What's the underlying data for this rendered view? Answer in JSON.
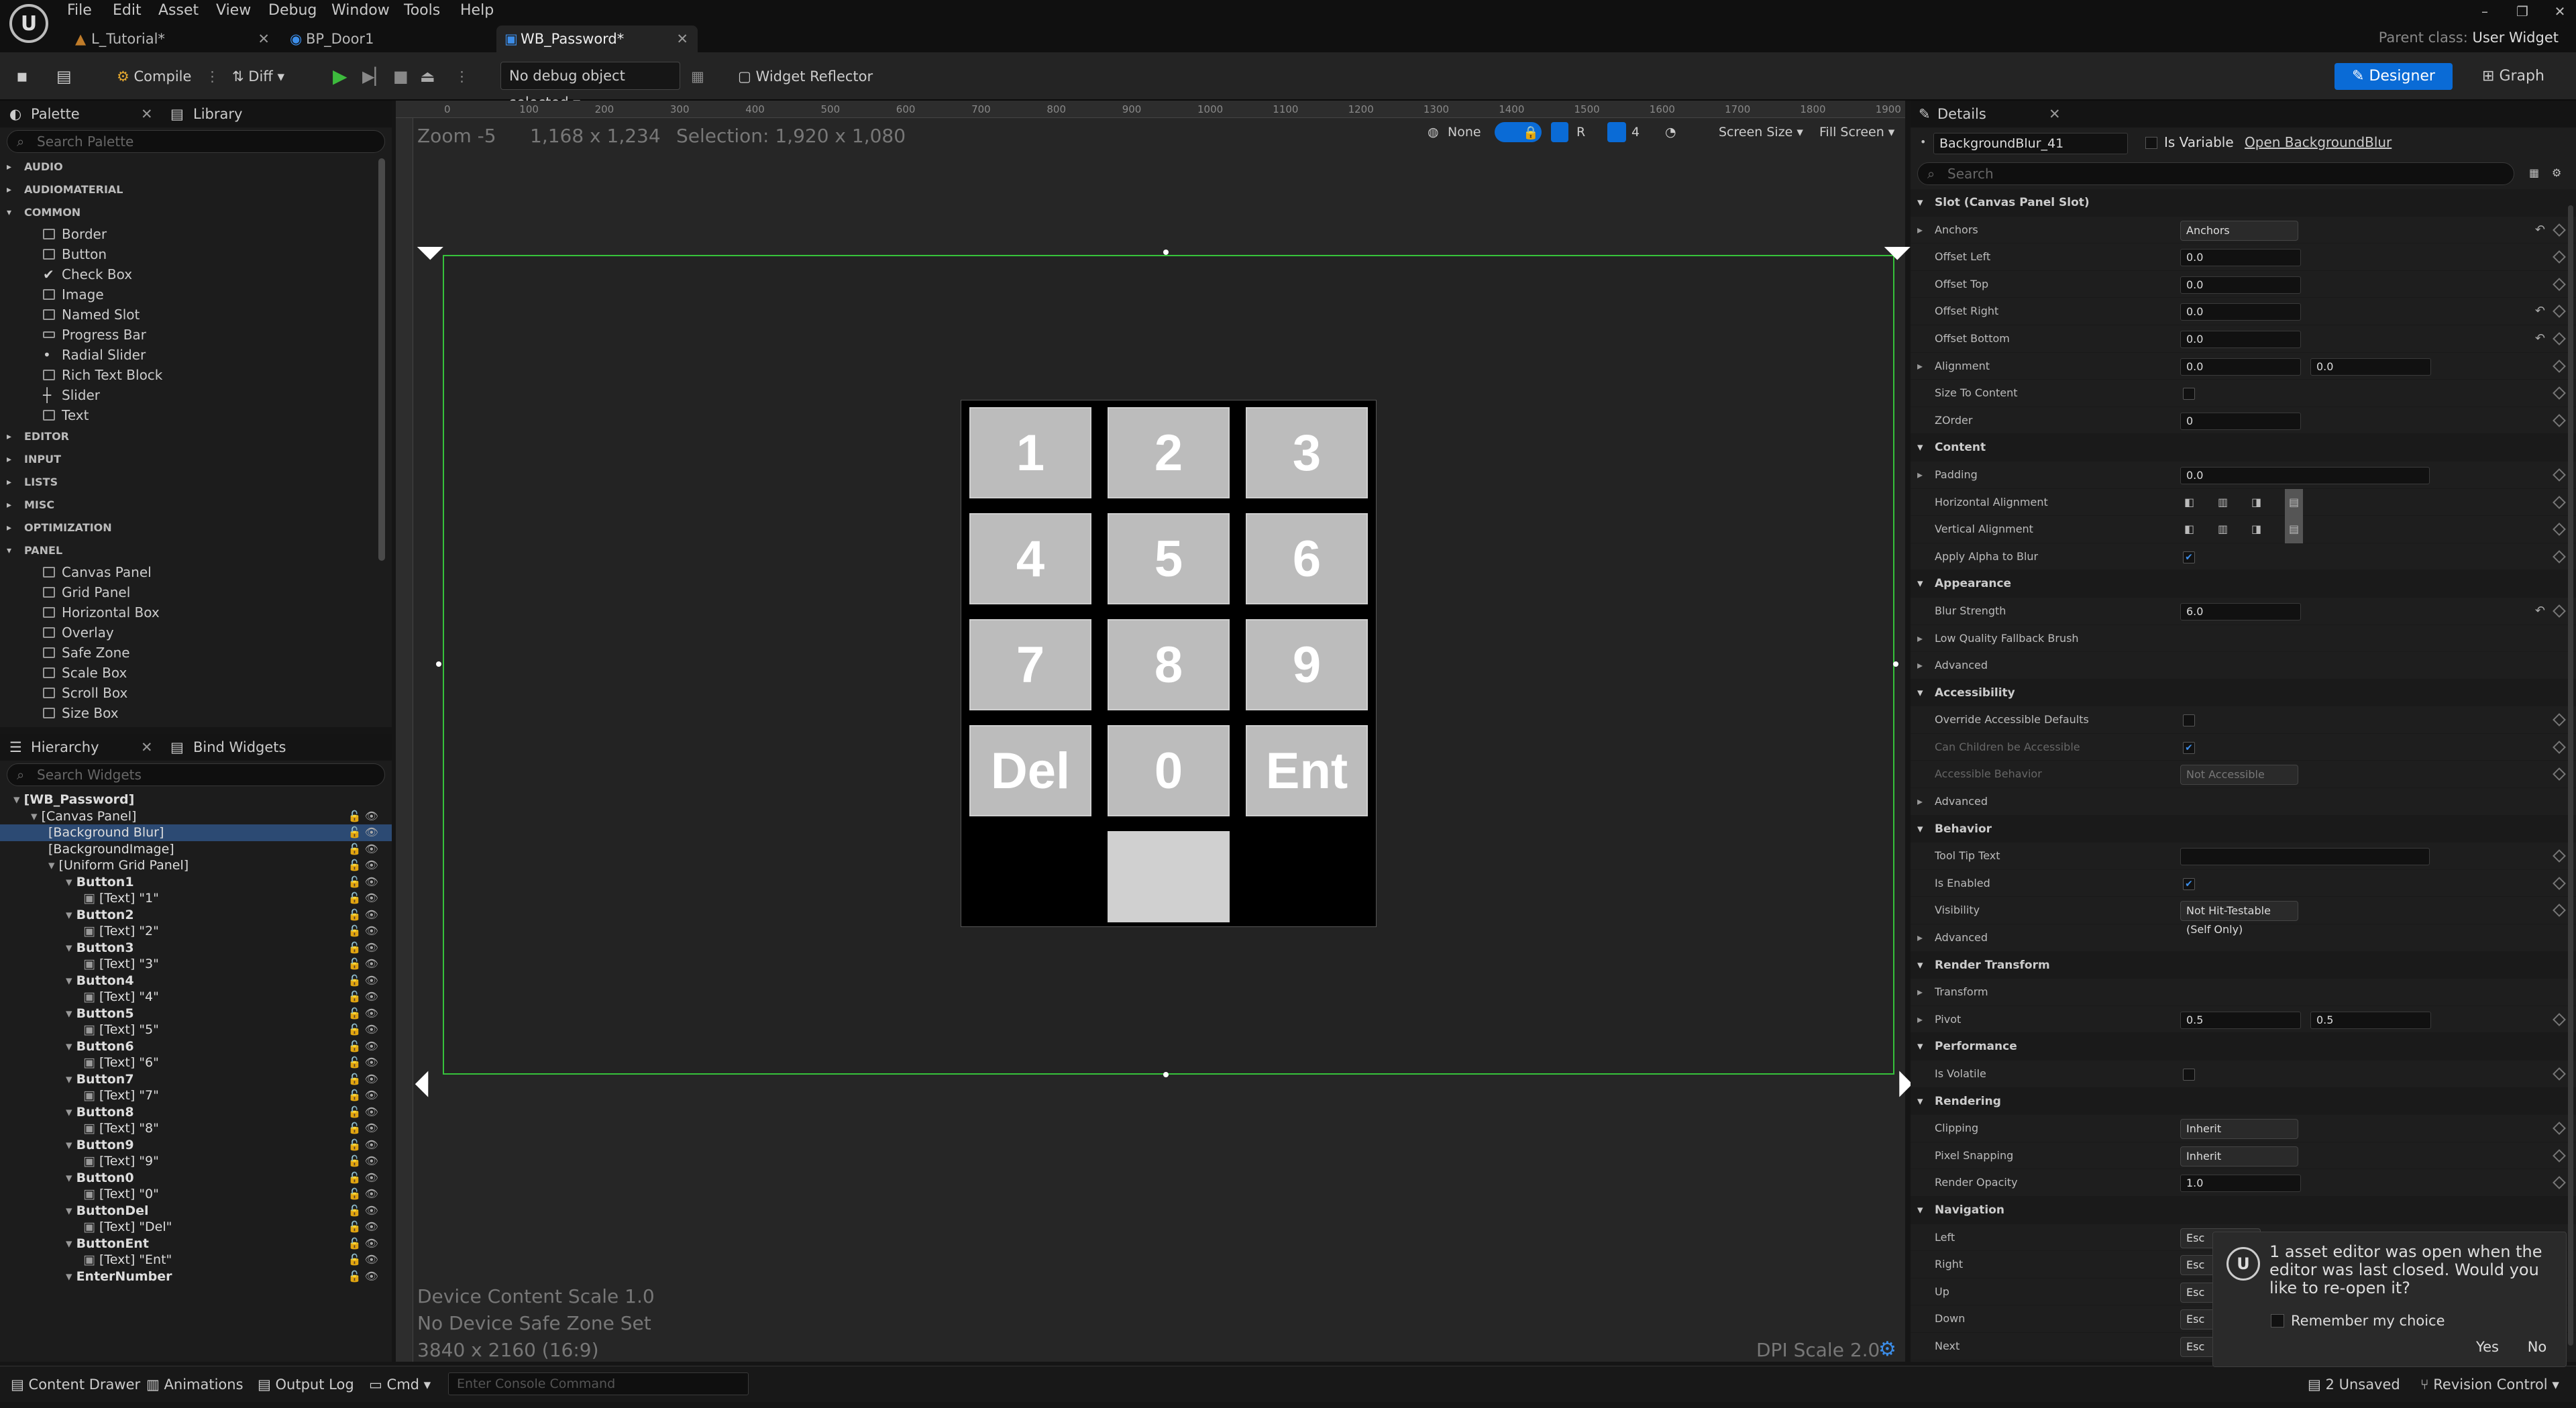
{
  "app": {
    "logo": "U",
    "menu": [
      "File",
      "Edit",
      "Asset",
      "View",
      "Debug",
      "Window",
      "Tools",
      "Help"
    ],
    "tabs": [
      {
        "label": "L_Tutorial*",
        "active": false
      },
      {
        "label": "BP_Door1",
        "active": false
      },
      {
        "label": "WB_Password*",
        "active": true
      }
    ],
    "parent_class_label": "Parent class:",
    "parent_class_value": "User Widget"
  },
  "toolbar": {
    "compile": "Compile",
    "diff": "Diff",
    "debug_object": "No debug object selected",
    "widget_reflector": "Widget Reflector",
    "designer": "Designer",
    "graph": "Graph"
  },
  "palette": {
    "tab": "Palette",
    "library_tab": "Library",
    "search_placeholder": "Search Palette",
    "categories_before": [
      "AUDIO",
      "AUDIOMATERIAL"
    ],
    "common_label": "COMMON",
    "common_items": [
      "Border",
      "Button",
      "Check Box",
      "Image",
      "Named Slot",
      "Progress Bar",
      "Radial Slider",
      "Rich Text Block",
      "Slider",
      "Text"
    ],
    "categories_mid": [
      "EDITOR",
      "INPUT",
      "LISTS",
      "MISC",
      "OPTIMIZATION"
    ],
    "panel_label": "PANEL",
    "panel_items": [
      "Canvas Panel",
      "Grid Panel",
      "Horizontal Box",
      "Overlay",
      "Safe Zone",
      "Scale Box",
      "Scroll Box",
      "Size Box"
    ]
  },
  "hierarchy": {
    "tab": "Hierarchy",
    "bind_tab": "Bind Widgets",
    "search_placeholder": "Search Widgets",
    "items": [
      {
        "label": "[WB_Password]",
        "indent": 0,
        "bold": true
      },
      {
        "label": "[Canvas Panel]",
        "indent": 1
      },
      {
        "label": "[Background Blur]",
        "indent": 2,
        "selected": true
      },
      {
        "label": "[BackgroundImage]",
        "indent": 2
      },
      {
        "label": "[Uniform Grid Panel]",
        "indent": 2
      },
      {
        "label": "Button1",
        "indent": 3,
        "bold": true
      },
      {
        "label": "[Text] \"1\"",
        "indent": 4
      },
      {
        "label": "Button2",
        "indent": 3,
        "bold": true
      },
      {
        "label": "[Text] \"2\"",
        "indent": 4
      },
      {
        "label": "Button3",
        "indent": 3,
        "bold": true
      },
      {
        "label": "[Text] \"3\"",
        "indent": 4
      },
      {
        "label": "Button4",
        "indent": 3,
        "bold": true
      },
      {
        "label": "[Text] \"4\"",
        "indent": 4
      },
      {
        "label": "Button5",
        "indent": 3,
        "bold": true
      },
      {
        "label": "[Text] \"5\"",
        "indent": 4
      },
      {
        "label": "Button6",
        "indent": 3,
        "bold": true
      },
      {
        "label": "[Text] \"6\"",
        "indent": 4
      },
      {
        "label": "Button7",
        "indent": 3,
        "bold": true
      },
      {
        "label": "[Text] \"7\"",
        "indent": 4
      },
      {
        "label": "Button8",
        "indent": 3,
        "bold": true
      },
      {
        "label": "[Text] \"8\"",
        "indent": 4
      },
      {
        "label": "Button9",
        "indent": 3,
        "bold": true
      },
      {
        "label": "[Text] \"9\"",
        "indent": 4
      },
      {
        "label": "Button0",
        "indent": 3,
        "bold": true
      },
      {
        "label": "[Text] \"0\"",
        "indent": 4
      },
      {
        "label": "ButtonDel",
        "indent": 3,
        "bold": true
      },
      {
        "label": "[Text] \"Del\"",
        "indent": 4
      },
      {
        "label": "ButtonEnt",
        "indent": 3,
        "bold": true
      },
      {
        "label": "[Text] \"Ent\"",
        "indent": 4
      },
      {
        "label": "EnterNumber",
        "indent": 3,
        "bold": true
      }
    ]
  },
  "viewport": {
    "zoom": "Zoom -5",
    "mouse": "1,168 x 1,234",
    "selection": "Selection: 1,920 x 1,080",
    "ruler_ticks": [
      "0",
      "100",
      "200",
      "300",
      "400",
      "500",
      "600",
      "700",
      "800",
      "900",
      "1000",
      "1100",
      "1200",
      "1300",
      "1400",
      "1500",
      "1600",
      "1700",
      "1800",
      "1900"
    ],
    "toolbar": {
      "none": "None",
      "r": "R",
      "grid": "4",
      "screen_size": "Screen Size",
      "fill_screen": "Fill Screen"
    },
    "device_scale": "Device Content Scale 1.0",
    "safe_zone": "No Device Safe Zone Set",
    "resolution": "3840 x 2160 (16:9)",
    "dpi": "DPI Scale 2.0"
  },
  "keypad": {
    "keys": [
      "1",
      "2",
      "3",
      "4",
      "5",
      "6",
      "7",
      "8",
      "9",
      "Del",
      "0",
      "Ent"
    ]
  },
  "details": {
    "tab": "Details",
    "widget_name": "BackgroundBlur_41",
    "is_variable": "Is Variable",
    "open_link": "Open BackgroundBlur",
    "search_placeholder": "Search",
    "rows": [
      {
        "type": "section",
        "label": "Slot (Canvas Panel Slot)"
      },
      {
        "type": "dropdown",
        "label": "Anchors",
        "value": "Anchors",
        "expand": true,
        "reset": true
      },
      {
        "type": "value",
        "label": "Offset Left",
        "value": "0.0"
      },
      {
        "type": "value",
        "label": "Offset Top",
        "value": "0.0"
      },
      {
        "type": "value",
        "label": "Offset Right",
        "value": "0.0",
        "reset": true
      },
      {
        "type": "value",
        "label": "Offset Bottom",
        "value": "0.0",
        "reset": true
      },
      {
        "type": "value2",
        "label": "Alignment",
        "value": "0.0",
        "value2": "0.0",
        "expand": true
      },
      {
        "type": "check",
        "label": "Size To Content",
        "checked": false
      },
      {
        "type": "value",
        "label": "ZOrder",
        "value": "0"
      },
      {
        "type": "section",
        "label": "Content"
      },
      {
        "type": "wide",
        "label": "Padding",
        "value": "0.0",
        "expand": true
      },
      {
        "type": "align",
        "label": "Horizontal Alignment"
      },
      {
        "type": "align",
        "label": "Vertical Alignment"
      },
      {
        "type": "check",
        "label": "Apply Alpha to Blur",
        "checked": true
      },
      {
        "type": "section",
        "label": "Appearance"
      },
      {
        "type": "value",
        "label": "Blur Strength",
        "value": "6.0",
        "reset": true
      },
      {
        "type": "plain",
        "label": "Low Quality Fallback Brush",
        "expand": true
      },
      {
        "type": "plain",
        "label": "Advanced",
        "expand": true
      },
      {
        "type": "section",
        "label": "Accessibility"
      },
      {
        "type": "check",
        "label": "Override Accessible Defaults",
        "checked": false
      },
      {
        "type": "check",
        "label": "Can Children be Accessible",
        "checked": true,
        "dim": true
      },
      {
        "type": "dropdown",
        "label": "Accessible Behavior",
        "value": "Not Accessible",
        "dim": true
      },
      {
        "type": "plain",
        "label": "Advanced",
        "expand": true
      },
      {
        "type": "section",
        "label": "Behavior"
      },
      {
        "type": "wide",
        "label": "Tool Tip Text",
        "value": ""
      },
      {
        "type": "check",
        "label": "Is Enabled",
        "checked": true
      },
      {
        "type": "dropdown",
        "label": "Visibility",
        "value": "Not Hit-Testable (Self Only)"
      },
      {
        "type": "plain",
        "label": "Advanced",
        "expand": true
      },
      {
        "type": "section",
        "label": "Render Transform"
      },
      {
        "type": "plain",
        "label": "Transform",
        "expand": true
      },
      {
        "type": "value2",
        "label": "Pivot",
        "value": "0.5",
        "value2": "0.5",
        "expand": true
      },
      {
        "type": "section",
        "label": "Performance"
      },
      {
        "type": "check",
        "label": "Is Volatile",
        "checked": false
      },
      {
        "type": "section",
        "label": "Rendering"
      },
      {
        "type": "dropdown",
        "label": "Clipping",
        "value": "Inherit"
      },
      {
        "type": "dropdown",
        "label": "Pixel Snapping",
        "value": "Inherit"
      },
      {
        "type": "value",
        "label": "Render Opacity",
        "value": "1.0"
      },
      {
        "type": "section",
        "label": "Navigation"
      },
      {
        "type": "nav",
        "label": "Left",
        "value": "Esc"
      },
      {
        "type": "nav",
        "label": "Right",
        "value": "Esc"
      },
      {
        "type": "nav",
        "label": "Up",
        "value": "Esc"
      },
      {
        "type": "nav",
        "label": "Down",
        "value": "Esc"
      },
      {
        "type": "nav",
        "label": "Next",
        "value": "Esc"
      }
    ]
  },
  "statusbar": {
    "content_drawer": "Content Drawer",
    "animations": "Animations",
    "output_log": "Output Log",
    "cmd": "Cmd",
    "console_placeholder": "Enter Console Command",
    "unsaved": "2 Unsaved",
    "revision": "Revision Control"
  },
  "toast": {
    "message": "1 asset editor was open when the editor was last closed. Would you like to re-open it?",
    "remember": "Remember my choice",
    "yes": "Yes",
    "no": "No"
  },
  "colors": {
    "accent": "#0a6bd6",
    "selection_outline": "#36c23b",
    "key_fill": "#bcbcbc"
  }
}
